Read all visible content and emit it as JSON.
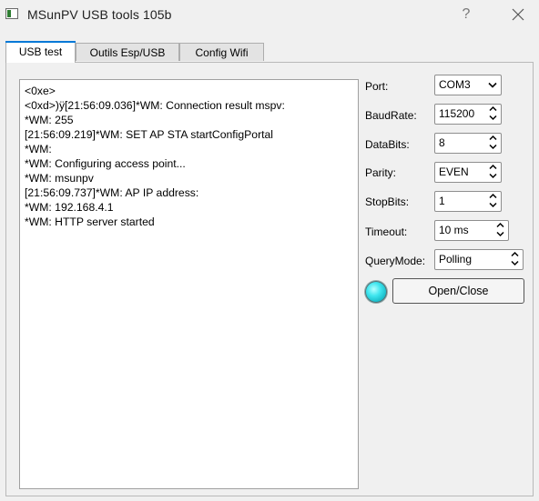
{
  "window": {
    "title": "MSunPV USB tools 105b",
    "help_glyph": "?",
    "icons": {
      "app": "app-window-icon",
      "close": "close-icon"
    }
  },
  "tabs": [
    {
      "label": "USB test",
      "active": true
    },
    {
      "label": "Outils Esp/USB",
      "active": false
    },
    {
      "label": "Config Wifi",
      "active": false
    }
  ],
  "console": {
    "lines": [
      "<0xe>",
      "<0xd>)ÿ[21:56:09.036]*WM: Connection result mspv:",
      "*WM: 255",
      "[21:56:09.219]*WM: SET AP STA startConfigPortal",
      "*WM:",
      "*WM: Configuring access point...",
      "*WM: msunpv",
      "[21:56:09.737]*WM: AP IP address:",
      "*WM: 192.168.4.1",
      "*WM: HTTP server started"
    ]
  },
  "settings": {
    "port": {
      "label": "Port:",
      "value": "COM3",
      "control": "dropdown"
    },
    "baudrate": {
      "label": "BaudRate:",
      "value": "115200",
      "control": "spinner"
    },
    "databits": {
      "label": "DataBits:",
      "value": "8",
      "control": "spinner"
    },
    "parity": {
      "label": "Parity:",
      "value": "EVEN",
      "control": "spinner"
    },
    "stopbits": {
      "label": "StopBits:",
      "value": "1",
      "control": "spinner"
    },
    "timeout": {
      "label": "Timeout:",
      "value": "10 ms",
      "control": "spinner"
    },
    "querymode": {
      "label": "QueryMode:",
      "value": "Polling",
      "control": "spinner"
    }
  },
  "status_led": {
    "color": "#2fd8e3",
    "icon": "status-led-icon"
  },
  "actions": {
    "open_close_label": "Open/Close"
  },
  "colors": {
    "accent": "#0078d7",
    "background": "#f0f0f0"
  }
}
